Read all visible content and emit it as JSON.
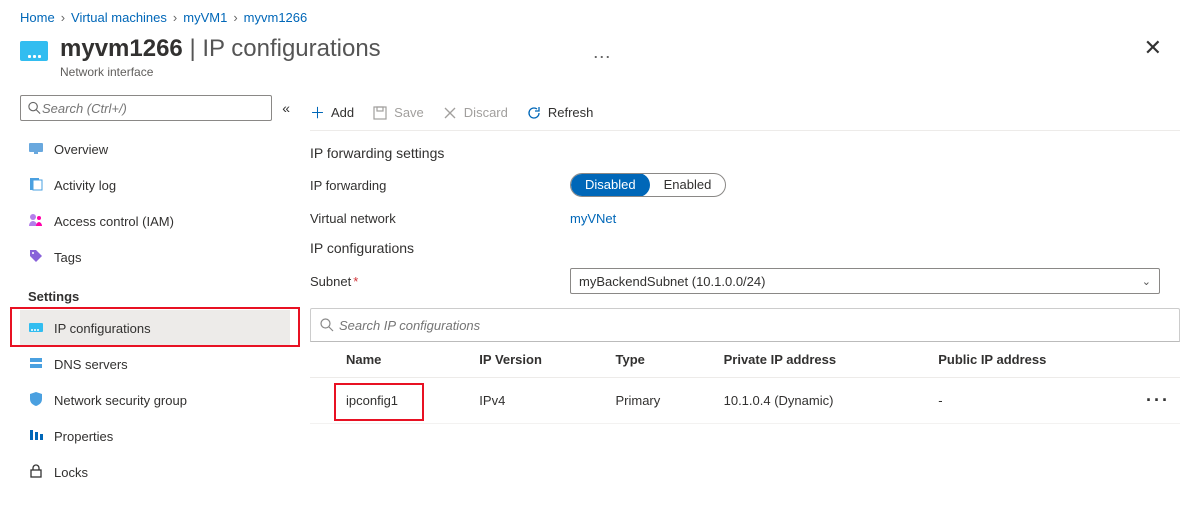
{
  "breadcrumb": [
    "Home",
    "Virtual machines",
    "myVM1",
    "myvm1266"
  ],
  "header": {
    "title_bold": "myvm1266",
    "title_light": "IP configurations",
    "subtitle": "Network interface"
  },
  "search_placeholder": "Search (Ctrl+/)",
  "nav": {
    "general": [
      {
        "icon": "overview",
        "label": "Overview"
      },
      {
        "icon": "activity",
        "label": "Activity log"
      },
      {
        "icon": "iam",
        "label": "Access control (IAM)"
      },
      {
        "icon": "tags",
        "label": "Tags"
      }
    ],
    "settings_heading": "Settings",
    "settings": [
      {
        "icon": "ipconfig",
        "label": "IP configurations",
        "selected": true,
        "highlight": true
      },
      {
        "icon": "dns",
        "label": "DNS servers"
      },
      {
        "icon": "nsg",
        "label": "Network security group"
      },
      {
        "icon": "props",
        "label": "Properties"
      },
      {
        "icon": "locks",
        "label": "Locks"
      }
    ]
  },
  "toolbar": {
    "add": "Add",
    "save": "Save",
    "discard": "Discard",
    "refresh": "Refresh"
  },
  "sections": {
    "forwarding_title": "IP forwarding settings",
    "forwarding_label": "IP forwarding",
    "toggle": {
      "off": "Disabled",
      "on": "Enabled",
      "value": "Disabled"
    },
    "vnet_label": "Virtual network",
    "vnet_value": "myVNet",
    "ipconfig_title": "IP configurations",
    "subnet_label": "Subnet",
    "subnet_value": "myBackendSubnet (10.1.0.0/24)"
  },
  "filter_placeholder": "Search IP configurations",
  "table": {
    "cols": [
      "Name",
      "IP Version",
      "Type",
      "Private IP address",
      "Public IP address"
    ],
    "rows": [
      {
        "name": "ipconfig1",
        "ipversion": "IPv4",
        "type": "Primary",
        "private": "10.1.0.4 (Dynamic)",
        "public": "-",
        "highlight_name": true
      }
    ]
  }
}
